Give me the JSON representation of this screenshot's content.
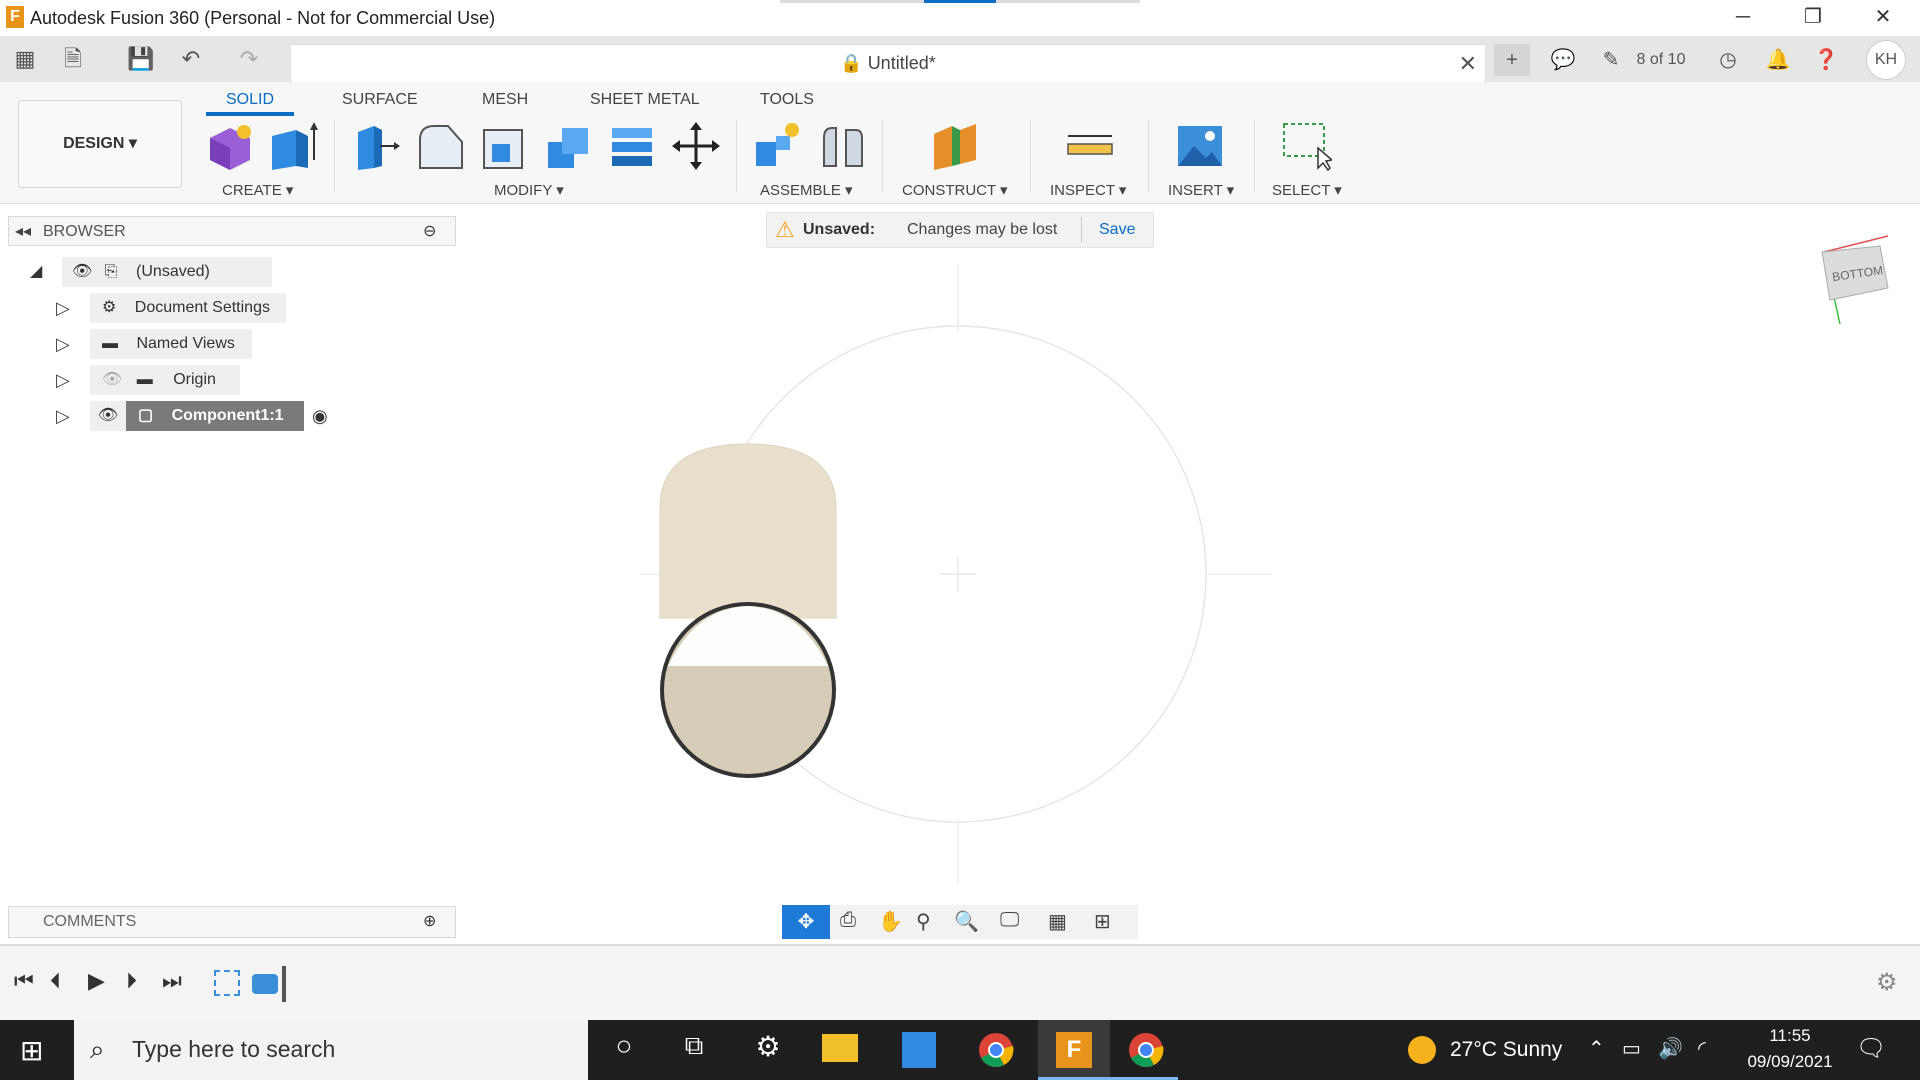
{
  "window": {
    "title": "Autodesk Fusion 360 (Personal - Not for Commercial Use)",
    "logo_letter": "F",
    "minimize": "─",
    "restore": "❐",
    "close": "✕"
  },
  "document": {
    "name": "Untitled*",
    "close": "✕",
    "version": "8 of 10",
    "avatar": "KH"
  },
  "ribbon": {
    "tabs": [
      "SOLID",
      "SURFACE",
      "MESH",
      "SHEET METAL",
      "TOOLS"
    ],
    "active_tab": "SOLID",
    "workspace": "DESIGN ▾",
    "groups": [
      "CREATE ▾",
      "MODIFY ▾",
      "ASSEMBLE ▾",
      "CONSTRUCT ▾",
      "INSPECT ▾",
      "INSERT ▾",
      "SELECT ▾"
    ]
  },
  "browser": {
    "title": "BROWSER",
    "root": "(Unsaved)",
    "items": [
      "Document Settings",
      "Named Views",
      "Origin",
      "Component1:1"
    ]
  },
  "banner": {
    "label": "Unsaved:",
    "message": "Changes may be lost",
    "action": "Save"
  },
  "viewcube": {
    "face": "BOTTOM"
  },
  "comments": {
    "title": "COMMENTS"
  },
  "taskbar": {
    "search_placeholder": "Type here to search",
    "weather": "27°C  Sunny",
    "time": "11:55",
    "date": "09/09/2021"
  },
  "colors": {
    "accent": "#0a6cc4",
    "body_fill": "#e8dfcd",
    "warning": "#f0a020"
  }
}
